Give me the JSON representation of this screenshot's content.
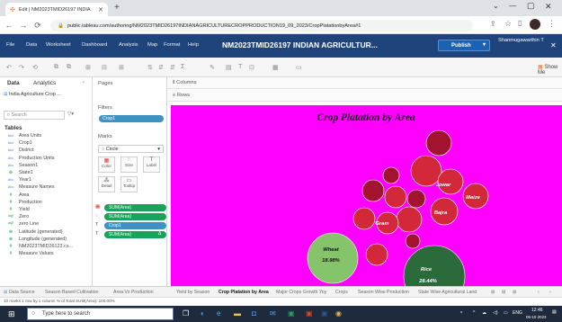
{
  "browser": {
    "tab_title": "Edit | NM2023TMID26197 INDIA",
    "url": "public.tableau.com/authoring/NM2023TMID26197INDIANAGRICULTURECROPPRODUCTION19_09_2023/CropPlatationbyArea#1"
  },
  "menu": [
    "File",
    "Data",
    "Worksheet",
    "Dashboard",
    "Analysis",
    "Map",
    "Format",
    "Help"
  ],
  "workbook_title": "NM2023TMID26197 INDIAN AGRICULTUR...",
  "publish_label": "Publish",
  "user_name": "Shanmugawarthin T",
  "show_me_label": "Show Me",
  "data_pane": {
    "tabs": [
      "Data",
      "Analytics"
    ],
    "datasource": "India Agriculture Crop ...",
    "search_placeholder": "Search",
    "tables_label": "Tables",
    "fields": [
      {
        "name": "Area Units",
        "type": "Abc"
      },
      {
        "name": "Crop1",
        "type": "Abc"
      },
      {
        "name": "District",
        "type": "Abc"
      },
      {
        "name": "Production Units",
        "type": "Abc"
      },
      {
        "name": "Season1",
        "type": "Abc"
      },
      {
        "name": "State1",
        "type": "geo"
      },
      {
        "name": "Year1",
        "type": "Abc"
      },
      {
        "name": "Measure Names",
        "type": "Abc"
      },
      {
        "name": "Area",
        "type": "#"
      },
      {
        "name": "Production",
        "type": "#"
      },
      {
        "name": "Yield",
        "type": "#"
      },
      {
        "name": "Zero",
        "type": "=#"
      },
      {
        "name": "zero Line",
        "type": "=#"
      },
      {
        "name": "Latitude (generated)",
        "type": "geo"
      },
      {
        "name": "Longitude (generated)",
        "type": "geo"
      },
      {
        "name": "NM2023TMID26123.cs...",
        "type": "#"
      },
      {
        "name": "Measure Values",
        "type": "#"
      }
    ]
  },
  "cards": {
    "pages": "Pages",
    "filters": "Filters",
    "filter_pill": "Crop1",
    "marks": "Marks",
    "mark_type": "Circle",
    "buttons": [
      "Color",
      "Size",
      "Label",
      "Detail",
      "Tooltip"
    ],
    "marks_pills": [
      "SUM(Area)",
      "SUM(Area)",
      "Crop1",
      "SUM(Area)"
    ]
  },
  "shelves": {
    "columns": "Columns",
    "rows": "Rows"
  },
  "chart_data": {
    "type": "packed bubble",
    "title": "Crop Platation by Area",
    "labels": [
      {
        "name": "Rice",
        "value": "28.44%"
      },
      {
        "name": "Wheat",
        "value": "18.98%"
      },
      {
        "name": "Jowar",
        "value": ""
      },
      {
        "name": "Maize",
        "value": ""
      },
      {
        "name": "Bajra",
        "value": ""
      },
      {
        "name": "Gram",
        "value": ""
      }
    ],
    "colors": {
      "background": "#ff00ff",
      "rice": "#2b6a3a",
      "wheat": "#85c46a",
      "others": "#d3283a",
      "dark": "#a3132f"
    }
  },
  "sheet_tabs": [
    "Season Based Cultivation",
    "Area Vs Production",
    "Yield by Season",
    "Crop Platation by Area",
    "Major Crops Growth Yoy",
    "Crops",
    "Season Wise Production",
    "State Wise Agricultural Land"
  ],
  "active_tab": "Crop Platation by Area",
  "data_source_tab": "Data Source",
  "status_text": "10 marks   1 row by 1 column   % of Total SUM(Area): 100.00%",
  "taskbar": {
    "search_placeholder": "Type here to search",
    "lang": "ENG",
    "time": "12:46",
    "date": "05-10-2023"
  }
}
